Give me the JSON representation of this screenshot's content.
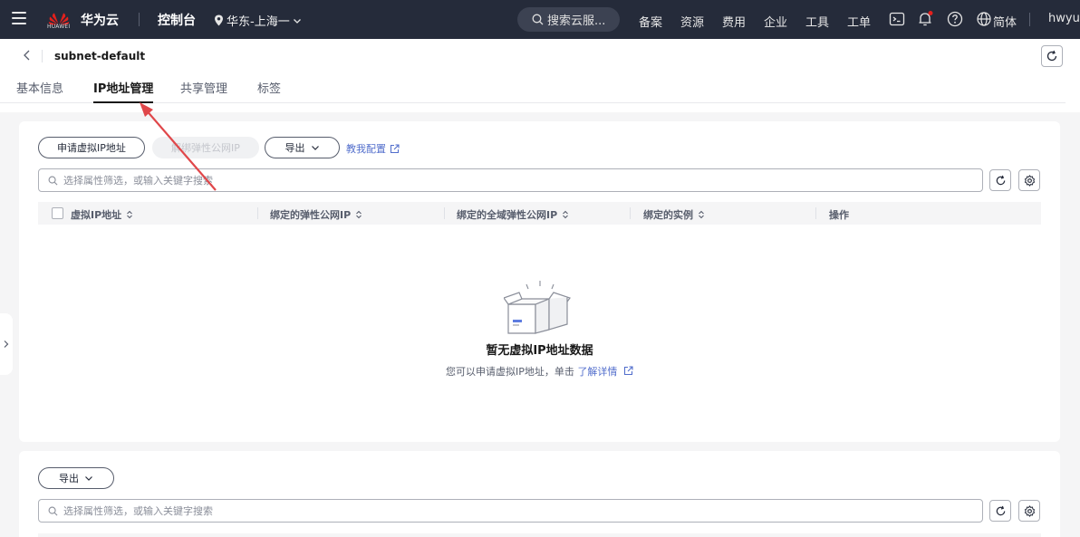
{
  "topbar": {
    "brand": "华为云",
    "logo_text": "HUAWEI",
    "console": "控制台",
    "region": "华东-上海一",
    "search_placeholder": "搜索云服...",
    "nav": [
      "备案",
      "资源",
      "费用",
      "企业",
      "工具",
      "工单"
    ],
    "lang": "简体",
    "user": "hwyun",
    "colors": {
      "bg": "#252b3a",
      "logo": "#e3201c",
      "badge": "#e3201c"
    }
  },
  "header": {
    "title": "subnet-default",
    "tabs": [
      "基本信息",
      "IP地址管理",
      "共享管理",
      "标签"
    ],
    "active_tab": "IP地址管理"
  },
  "card1": {
    "buttons": {
      "apply": "申请虚拟IP地址",
      "release": "解绑弹性公网IP",
      "export": "导出"
    },
    "config_link": "教我配置",
    "search_placeholder": "选择属性筛选，或输入关键字搜索",
    "columns": [
      "虚拟IP地址",
      "绑定的弹性公网IP",
      "绑定的全域弹性公网IP",
      "绑定的实例",
      "操作"
    ],
    "empty_title": "暂无虚拟IP地址数据",
    "empty_desc": "您可以申请虚拟IP地址，单击",
    "empty_link": "了解详情"
  },
  "card2": {
    "export": "导出",
    "search_placeholder": "选择属性筛选，或输入关键字搜索"
  },
  "annotation": {
    "arrow_color": "#e0474a"
  }
}
